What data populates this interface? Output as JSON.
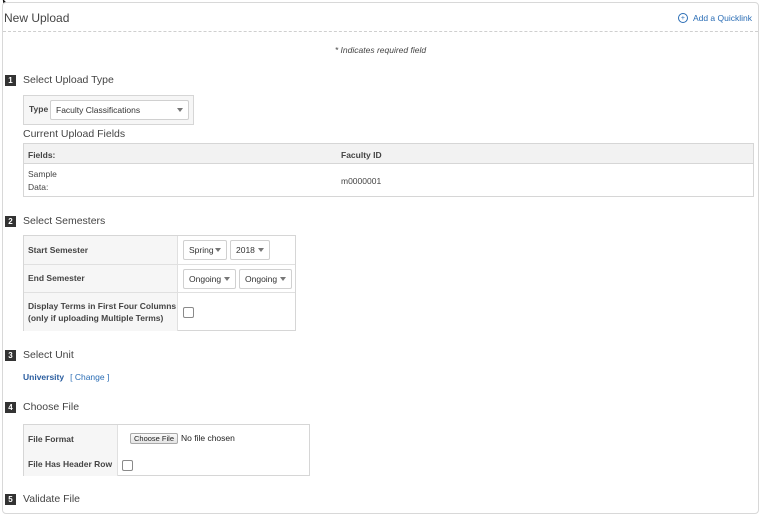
{
  "header": {
    "title": "New Upload",
    "quicklink_label": "Add a Quicklink",
    "quicklink_icon": "plus-circle-icon"
  },
  "required_note": "* Indicates required field",
  "steps": {
    "s1": {
      "num": "1",
      "label": "Select Upload Type"
    },
    "s2": {
      "num": "2",
      "label": "Select Semesters"
    },
    "s3": {
      "num": "3",
      "label": "Select Unit"
    },
    "s4": {
      "num": "4",
      "label": "Choose File"
    },
    "s5": {
      "num": "5",
      "label": "Validate File"
    }
  },
  "upload_type": {
    "label": "Type",
    "selected": "Faculty Classifications"
  },
  "current_fields": {
    "title": "Current Upload Fields",
    "header_label": "Fields:",
    "header_value": "Faculty ID",
    "sample_label_line1": "Sample",
    "sample_label_line2": "Data:",
    "sample_value": "m0000001"
  },
  "semesters": {
    "start_label": "Start Semester",
    "start_term": "Spring",
    "start_year": "2018",
    "end_label": "End Semester",
    "end_term": "Ongoing",
    "end_year": "Ongoing",
    "display_terms_line1": "Display Terms in First Four Columns",
    "display_terms_line2": "(only if uploading Multiple Terms)",
    "display_terms_checked": false
  },
  "unit": {
    "name": "University",
    "change_label": "[ Change ]"
  },
  "file": {
    "format_label": "File Format",
    "choose_button": "Choose File",
    "no_file_text": "No file chosen",
    "header_row_label": "File Has Header Row",
    "header_row_checked": false
  }
}
